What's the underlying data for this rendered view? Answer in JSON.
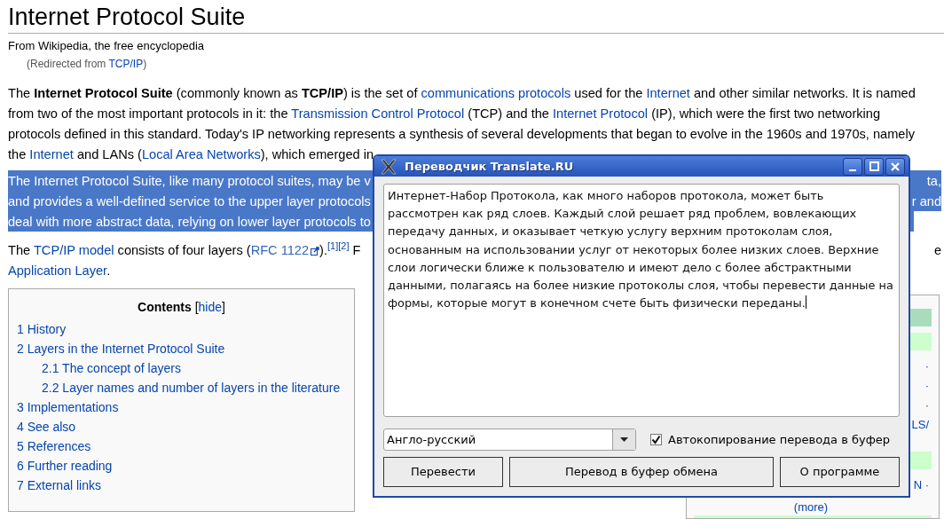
{
  "article": {
    "title": "Internet Protocol Suite",
    "tagline": "From Wikipedia, the free encyclopedia",
    "redirect": {
      "before": "(Redirected from ",
      "link": "TCP/IP",
      "after": ")"
    },
    "paragraphs": [
      {
        "highlighted": false,
        "lines": [
          {
            "segments": [
              {
                "kind": "text",
                "text": "The "
              },
              {
                "kind": "bold",
                "text": "Internet Protocol Suite"
              },
              {
                "kind": "text",
                "text": " (commonly known as "
              },
              {
                "kind": "bold",
                "text": "TCP/IP"
              },
              {
                "kind": "text",
                "text": ") is the set of "
              },
              {
                "kind": "link",
                "text": "communications protocols"
              },
              {
                "kind": "text",
                "text": " used for the "
              },
              {
                "kind": "link",
                "text": "Internet"
              },
              {
                "kind": "text",
                "text": " and other similar networks. It is named"
              }
            ]
          },
          {
            "segments": [
              {
                "kind": "text",
                "text": "from two of the most important protocols in it: the "
              },
              {
                "kind": "link",
                "text": "Transmission Control Protocol"
              },
              {
                "kind": "text",
                "text": " (TCP) and the "
              },
              {
                "kind": "link",
                "text": "Internet Protocol"
              },
              {
                "kind": "text",
                "text": " (IP), which were the first two networking"
              }
            ]
          },
          {
            "segments": [
              {
                "kind": "text",
                "text": "protocols defined in this standard. Today's IP networking represents a synthesis of several developments that began to evolve in the 1960s and 1970s, namely"
              }
            ]
          },
          {
            "segments": [
              {
                "kind": "text",
                "text": "the "
              },
              {
                "kind": "link",
                "text": "Internet"
              },
              {
                "kind": "text",
                "text": " and LANs ("
              },
              {
                "kind": "link",
                "text": "Local Area Networks"
              },
              {
                "kind": "text",
                "text": "), which emerged in"
              }
            ]
          }
        ]
      },
      {
        "highlighted": true,
        "lines": [
          {
            "segments": [
              {
                "kind": "text",
                "text": "The Internet Protocol Suite, like many protocol suites, may be v"
              }
            ],
            "tail": "ta,"
          },
          {
            "segments": [
              {
                "kind": "text",
                "text": "and provides a well-defined service to the upper layer protocols"
              }
            ],
            "tail": "r and"
          },
          {
            "segments": [
              {
                "kind": "text",
                "text": "deal with more abstract data, relying on lower layer protocols to"
              }
            ]
          }
        ]
      },
      {
        "highlighted": false,
        "lines": [
          {
            "segments": [
              {
                "kind": "text",
                "text": "The "
              },
              {
                "kind": "link",
                "text": "TCP/IP model"
              },
              {
                "kind": "text",
                "text": " consists of four layers ("
              },
              {
                "kind": "extlink",
                "text": "RFC 1122"
              },
              {
                "kind": "text",
                "text": ")."
              },
              {
                "kind": "sup",
                "text": "[1]"
              },
              {
                "kind": "sup",
                "text": "[2]"
              },
              {
                "kind": "text",
                "text": " F"
              }
            ],
            "tail": "e"
          },
          {
            "segments": [
              {
                "kind": "link",
                "text": "Application Layer"
              },
              {
                "kind": "text",
                "text": "."
              }
            ]
          }
        ]
      }
    ]
  },
  "toc": {
    "title": "Contents",
    "toggle_before": "[",
    "toggle": "hide",
    "toggle_after": "]",
    "items": [
      {
        "number": "1",
        "label": "History"
      },
      {
        "number": "2",
        "label": "Layers in the Internet Protocol Suite",
        "children": [
          {
            "number": "2.1",
            "label": "The concept of layers"
          },
          {
            "number": "2.2",
            "label": "Layer names and number of layers in the literature"
          }
        ]
      },
      {
        "number": "3",
        "label": "Implementations"
      },
      {
        "number": "4",
        "label": "See also"
      },
      {
        "number": "5",
        "label": "References"
      },
      {
        "number": "6",
        "label": "Further reading"
      },
      {
        "number": "7",
        "label": "External links"
      }
    ]
  },
  "sidebar": {
    "items": [
      {
        "kind": "header"
      },
      {
        "kind": "band"
      },
      {
        "kind": "fragment",
        "text": "·"
      },
      {
        "kind": "fragment",
        "text": "·"
      },
      {
        "kind": "fragment",
        "text": "·"
      },
      {
        "kind": "fragment",
        "text": "LS/"
      },
      {
        "kind": "spacer"
      },
      {
        "kind": "band"
      },
      {
        "kind": "fragment",
        "text": "N ·"
      },
      {
        "kind": "more",
        "text": "(more)"
      },
      {
        "kind": "band"
      }
    ]
  },
  "dialog": {
    "title": "Переводчик Translate.RU",
    "translation": "Интернет-Набор Протокола, как много наборов протокола, может быть рассмотрен как ряд слоев. Каждый слой решает ряд проблем, вовлекающих передачу данных, и оказывает четкую услугу верхним протоколам слоя, основанным на использовании услуг от некоторых более низких слоев. Верхние слои логически ближе к пользователю и имеют дело с более абстрактными данными, полагаясь на более низкие протоколы слоя, чтобы перевести данные на формы, которые могут в конечном счете быть физически переданы.",
    "direction": "Англо-русский",
    "autocopy": {
      "label": "Автокопирование перевода в буфер",
      "checked": true
    },
    "buttons": [
      "Перевести",
      "Перевод в буфер обмена",
      "О программе"
    ]
  }
}
